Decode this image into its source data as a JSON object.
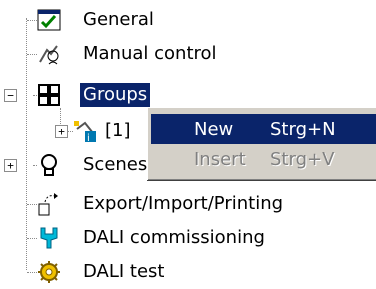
{
  "tree": {
    "items": [
      {
        "label": "General",
        "icon": "general-settings-icon"
      },
      {
        "label": "Manual control",
        "icon": "manual-control-icon"
      },
      {
        "label": "Groups",
        "icon": "groups-grid-icon",
        "selected": true
      },
      {
        "label": "[1] ",
        "icon": "group-item-icon"
      },
      {
        "label": "Scenes",
        "icon": "scenes-bulb-icon"
      },
      {
        "label": "Export/Import/Printing",
        "icon": "export-import-icon"
      },
      {
        "label": "DALI commissioning",
        "icon": "dali-commissioning-icon"
      },
      {
        "label": "DALI test",
        "icon": "dali-test-icon"
      }
    ]
  },
  "context_menu": {
    "items": [
      {
        "label": "New",
        "shortcut": "Strg+N",
        "state": "highlighted"
      },
      {
        "label": "Insert",
        "shortcut": "Strg+V",
        "state": "disabled"
      }
    ]
  },
  "colors": {
    "selection": "#0a246a",
    "menu_bg": "#d4d0c8",
    "disabled_text": "#808080"
  }
}
